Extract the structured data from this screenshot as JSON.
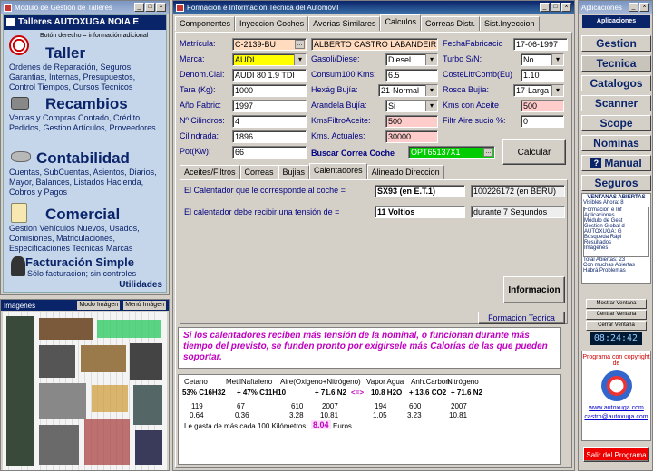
{
  "left_window": {
    "title": "Módulo de Gestión de Talleres",
    "header": "Talleres AUTOXUGA NOIA E",
    "hint": "Botón derecho = información adicional",
    "sections": [
      {
        "title": "Taller",
        "text": "Ordenes de Reparación, Seguros, Garantias, Internas, Presupuestos, Control Tiempos, Cursos Tecnicos"
      },
      {
        "title": "Recambios",
        "text": "Ventas y Compras Contado, Crédito, Pedidos, Gestion Artículos, Proveedores"
      },
      {
        "title": "Contabilidad",
        "text": "Cuentas, SubCuentas, Asientos, Diarios, Mayor, Balances, Listados Hacienda, Cobros y Pagos"
      },
      {
        "title": "Comercial",
        "text": "Gestion Vehículos Nuevos, Usados, Comisiones, Matriculaciones, Especificaciones Tecnicas Marcas"
      },
      {
        "title": "Facturación Simple",
        "text": "Sólo facturacion; sin controles"
      }
    ],
    "utilidades": "Utilidades"
  },
  "images_panel": {
    "title": "Imágenes",
    "mode_label": "Modo Imágen",
    "menu_label": "Menú Imágen"
  },
  "main_window": {
    "title": "Formacion e Informacion Tecnica del Automovil",
    "tabs": [
      "Componentes",
      "Inyeccion Coches",
      "Averias Similares",
      "Calculos",
      "Correas Distr.",
      "Sist.Inyeccion"
    ],
    "active_tab": "Calculos",
    "fields": {
      "matricula_label": "Matrícula:",
      "matricula": "C-2139-BU",
      "owner": "ALBERTO CASTRO LABANDEIR",
      "fecha_label": "FechaFabricacio",
      "fecha": "17-06-1997",
      "marca_label": "Marca:",
      "marca": "AUDI",
      "gasoli_label": "Gasoli/Diese:",
      "gasoli": "Diesel",
      "turbo_label": "Turbo S/N:",
      "turbo": "No",
      "denom_label": "Denom.Cial:",
      "denom": "AUDI 80 1.9 TDI",
      "consum_label": "Consum100 Kms:",
      "consum": "6.5",
      "coste_label": "CosteLitrComb(Eu)",
      "coste": "1.10",
      "tara_label": "Tara (Kg):",
      "tara": "1000",
      "hexag_label": "Hexág Bujía:",
      "hexag": "21-Normal",
      "rosca_label": "Rosca Bujía:",
      "rosca": "17-Larga",
      "anio_label": "Año Fabric:",
      "anio": "1997",
      "arandela_label": "Arandela Bujía:",
      "arandela": "Si",
      "kmsaceite_label": "Kms con Aceite",
      "kmsaceite": "500",
      "cil_label": "Nº Cilindros:",
      "cil": "4",
      "kmsfiltro_label": "KmsFiltroAceite:",
      "kmsfiltro": "500",
      "filtro_label": "Filtr Aire sucio %:",
      "filtro": "0",
      "cilindrada_label": "Cilindrada:",
      "cilindrada": "1896",
      "kmsact_label": "Kms. Actuales:",
      "kmsact": "30000",
      "pot_label": "Pot(Kw):",
      "pot": "66",
      "buscar_label": "Buscar Correa Coche",
      "buscar": "OPT65137X1"
    },
    "calcular": "Calcular",
    "subtabs": [
      "Aceites/Filtros",
      "Correas",
      "Bujias",
      "Calentadores",
      "Alineado Direccion"
    ],
    "active_subtab": "Calentadores",
    "calentador_label": "El Calentador que le corresponde al coche =",
    "calentador_value": "SX93 (en E.T.1)",
    "calentador_ref": "100226172 (en BERU)",
    "tension_label": "El calentador debe recibir una tensión de =",
    "tension_value": "11 Voltios",
    "tension_time": "durante 7 Segundos",
    "informacion": "Informacion",
    "formacion": "Formacion Teorica",
    "warning": "Si los calentadores reciben más tensión de la nominal, o funcionan durante más tiempo del previsto, se funden pronto por exigirsele más Calorías de las que pueden soportar.",
    "chem": {
      "headers": [
        "Cetano",
        "MetilNaftaleno",
        "Aire(Oxigeno+Nitrógeno)",
        "Vapor Agua",
        "Anh.Carbon",
        "Nitrógeno"
      ],
      "formula": [
        "53% C16H32",
        "+ 47% C11H10",
        "+ 71.6 N2",
        "<=>",
        "10.8 H2O",
        "+ 13.6 CO2",
        "+ 71.6 N2"
      ],
      "row1": [
        "119",
        "67",
        "610",
        "2007",
        "194",
        "600",
        "2007"
      ],
      "row2": [
        "0.64",
        "0.36",
        "3.28",
        "10.81",
        "1.05",
        "3.23",
        "10.81"
      ],
      "footer": "Le gasta de más cada 100 Kilómetros",
      "footer_value": "8.04",
      "footer_unit": "Euros."
    }
  },
  "right_window": {
    "title": "Aplicaciones",
    "header": "Aplicaciones",
    "buttons": [
      "Gestion",
      "Tecnica",
      "Catalogos",
      "Scanner",
      "Scope",
      "Nominas",
      "Manual",
      "Seguros"
    ],
    "ventanas_title": "VENTANAS ABIERTAS",
    "visibles": "Visibles Ahora: 8",
    "open_windows": [
      "Formacion e Inf",
      "Aplicaciones",
      "Módulo de Gest",
      "Gestion Global d",
      "AUTOXUGA: G",
      "Búsqueda Rápi",
      "Resultados",
      "Imágenes"
    ],
    "total": "Total Abiertas: 23",
    "con_muchas": "Con muchas Abiertas",
    "habra": "Habrá Problemas",
    "mostrar": "Mostrar Ventana",
    "centrar": "Centrar Ventana",
    "cerrar": "Cerrar Ventana",
    "clock": "08:24:42",
    "programa": "Programa con copyright de",
    "url": "www.autoxuga.com",
    "email": "castro@autoxuga.com",
    "salir": "Salir del Programa"
  },
  "colors": {
    "accent": "#0a246a",
    "highlight_yellow": "#ffff00",
    "highlight_pink": "#ffcccc",
    "green": "#00cc00",
    "magenta": "#c000c0"
  }
}
